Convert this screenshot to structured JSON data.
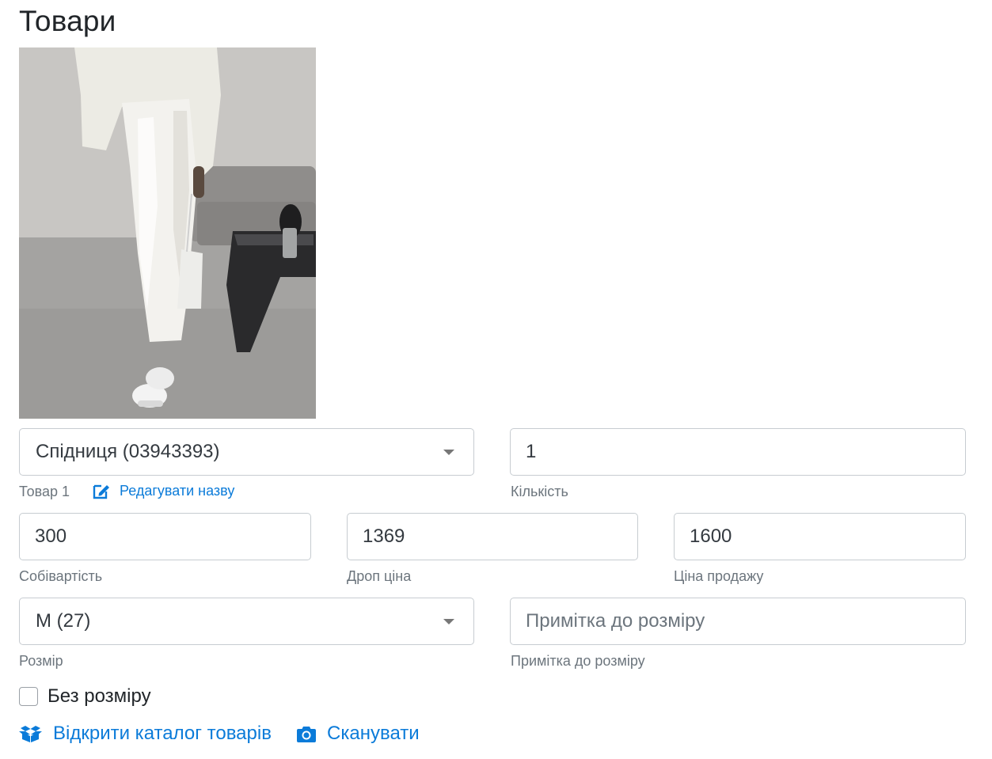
{
  "page": {
    "title": "Товари"
  },
  "product": {
    "name_value": "Спідниця (03943393)",
    "item_label": "Товар 1",
    "edit_name_label": "Редагувати назву",
    "quantity": {
      "value": "1",
      "label": "Кількість"
    },
    "cost": {
      "value": "300",
      "label": "Собівартість"
    },
    "drop_price": {
      "value": "1369",
      "label": "Дроп ціна"
    },
    "sale_price": {
      "value": "1600",
      "label": "Ціна продажу"
    },
    "size": {
      "value": "M (27)",
      "label": "Розмір"
    },
    "size_note": {
      "placeholder": "Примітка до розміру",
      "label": "Примітка до розміру"
    },
    "no_size": {
      "label": "Без розміру",
      "checked": false
    }
  },
  "actions": {
    "open_catalog": "Відкрити каталог товарів",
    "scan": "Сканувати"
  },
  "colors": {
    "accent": "#0b7bd9",
    "border": "#c7ccd1",
    "muted": "#6c757d"
  },
  "icons": {
    "edit": "edit-icon",
    "catalog": "box-icon",
    "scan": "camera-icon",
    "dropdown": "chevron-down-icon"
  }
}
